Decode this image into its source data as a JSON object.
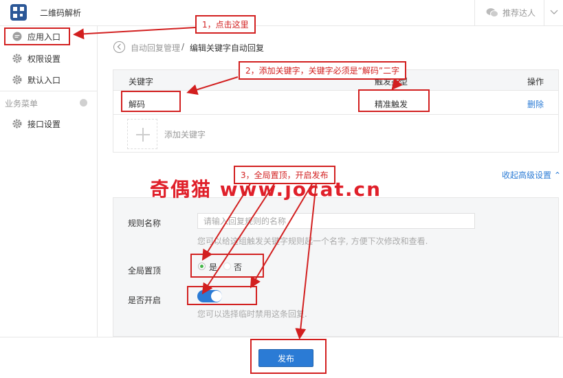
{
  "app": {
    "title": "二维码解析",
    "recommend_link": "推荐达人"
  },
  "sidebar": {
    "items": [
      {
        "label": "应用入口",
        "icon": "chat-bubble-icon"
      },
      {
        "label": "权限设置",
        "icon": "gear-icon"
      },
      {
        "label": "默认入口",
        "icon": "gear-icon"
      }
    ],
    "section_title": "业务菜单",
    "section_items": [
      {
        "label": "接口设置",
        "icon": "gear-icon"
      }
    ]
  },
  "breadcrumb": {
    "parent": "自动回复管理",
    "separator": "/",
    "current": "编辑关键字自动回复"
  },
  "keywords": {
    "col_keyword": "关键字",
    "col_trigger": "触发类型",
    "col_action": "操作",
    "rows": [
      {
        "keyword": "解码",
        "trigger": "精准触发",
        "action": "删除"
      }
    ],
    "add_label": "添加关键字"
  },
  "advanced": {
    "toggle_label": "收起高级设置",
    "rule_name_label": "规则名称",
    "rule_name_placeholder": "请输入回复规则的名称",
    "rule_name_hint": "您可以给这组触发关键字规则起一个名字, 方便下次修改和查看.",
    "pin_label": "全局置顶",
    "pin_yes": "是",
    "pin_no": "否",
    "pin_selected": "是",
    "enable_label": "是否开启",
    "enabled": true,
    "enable_hint": "您可以选择临时禁用这条回复."
  },
  "footer": {
    "publish_label": "发布"
  },
  "annotations": {
    "step1": "1，点击这里",
    "step2": "2，添加关键字，关键字必须是“解码”二字",
    "step3": "3，全局置顶，开启发布",
    "watermark": "奇偶猫 www.jocat.cn",
    "color": "#d21f1f"
  },
  "colors": {
    "accent": "#2b7bd5",
    "brand": "#2b5797",
    "annotation": "#d21f1f"
  }
}
